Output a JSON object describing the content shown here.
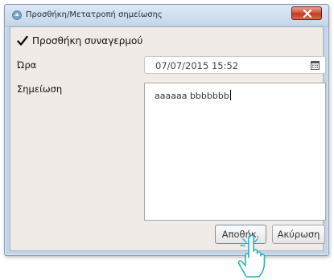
{
  "window": {
    "title": "Προσθήκη/Μετατροπή σημείωσης"
  },
  "form": {
    "alarm_checkbox_label": "Προσθήκη συναγερμού",
    "alarm_checked": true,
    "time_label": "Ώρα",
    "time_value": "07/07/2015 15:52",
    "note_label": "Σημείωση",
    "note_value": "aaaaaa bbbbbbb"
  },
  "buttons": {
    "save_label": "Αποθήκ.",
    "cancel_label": "Ακύρωση"
  },
  "icons": {
    "app": "app-icon",
    "close": "close-icon",
    "calendar": "calendar-icon",
    "pointer": "hand-pointer-icon"
  },
  "colors": {
    "title_bar": "#c6d6ea",
    "close_button": "#c13a22",
    "dialog_background": "#f0ebe6",
    "hand_outline": "#2ab0c4"
  }
}
